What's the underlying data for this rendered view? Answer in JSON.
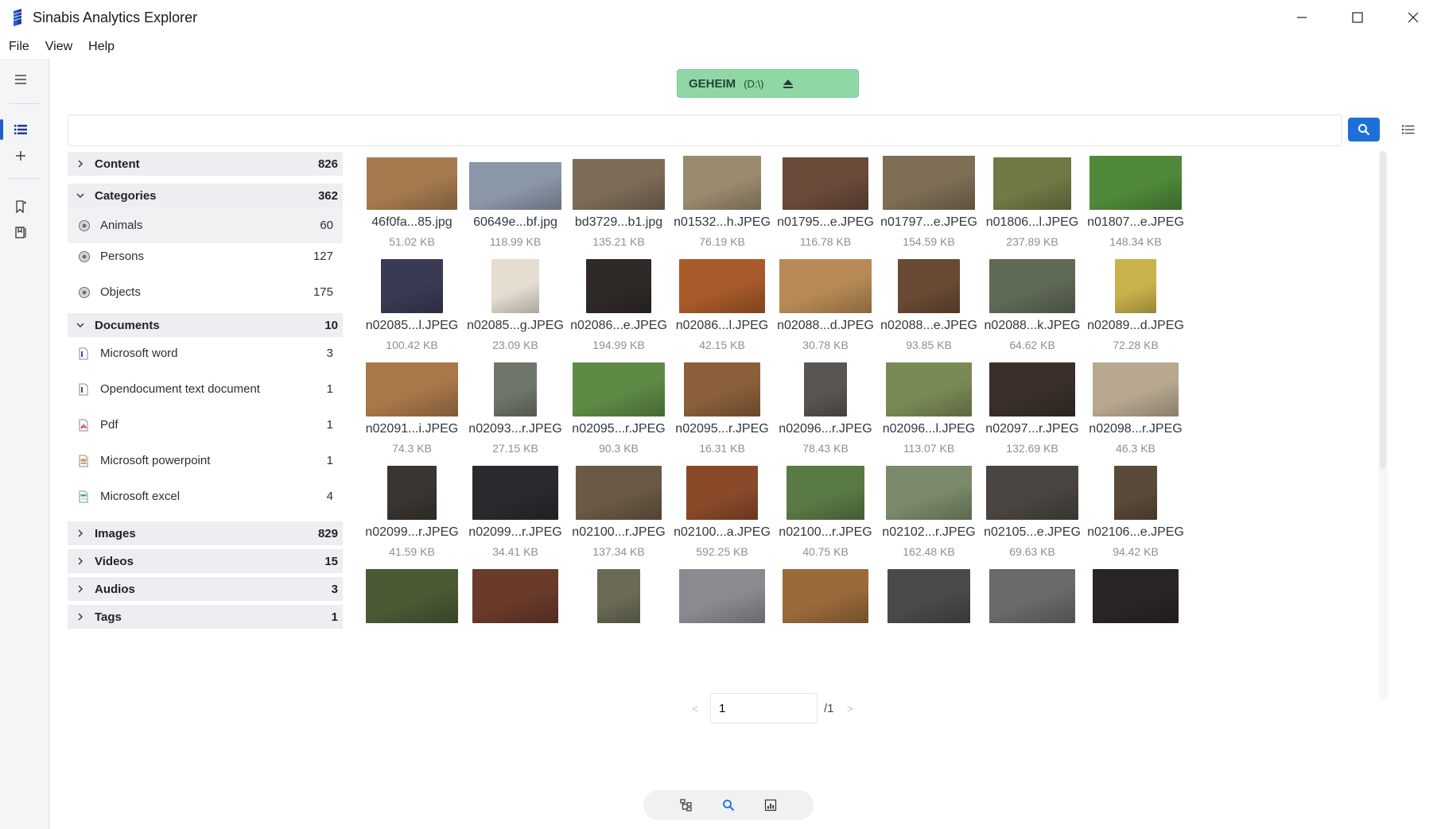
{
  "window": {
    "title": "Sinabis Analytics Explorer",
    "controls": [
      "minimize-icon",
      "maximize-icon",
      "close-icon"
    ]
  },
  "menu": [
    "File",
    "View",
    "Help"
  ],
  "rail": {
    "icons": [
      "hamburger-menu-icon",
      "list-view-icon",
      "plus-icon",
      "bookmark-add-icon",
      "bookmarks-icon"
    ],
    "active": "list-view-icon"
  },
  "drive": {
    "name": "GEHEIM",
    "path": "(D:\\)",
    "action_icon": "eject-icon",
    "color": "#8fd8a6"
  },
  "search": {
    "value": "",
    "placeholder": "",
    "button_icon": "search-icon",
    "accent": "#1e6fd9"
  },
  "facets": {
    "content": {
      "label": "Content",
      "count": "826",
      "expanded": false
    },
    "categories": {
      "label": "Categories",
      "count": "362",
      "expanded": true,
      "items": [
        {
          "label": "Animals",
          "count": "60",
          "selected": true
        },
        {
          "label": "Persons",
          "count": "127"
        },
        {
          "label": "Objects",
          "count": "175"
        }
      ]
    },
    "documents": {
      "label": "Documents",
      "count": "10",
      "expanded": true,
      "items": [
        {
          "label": "Microsoft word",
          "count": "3",
          "icon": "word-doc-icon"
        },
        {
          "label": "Opendocument text document",
          "count": "1",
          "icon": "odt-doc-icon"
        },
        {
          "label": "Pdf",
          "count": "1",
          "icon": "pdf-icon"
        },
        {
          "label": "Microsoft powerpoint",
          "count": "1",
          "icon": "powerpoint-icon"
        },
        {
          "label": "Microsoft excel",
          "count": "4",
          "icon": "excel-icon"
        }
      ]
    },
    "images": {
      "label": "Images",
      "count": "829",
      "expanded": false
    },
    "videos": {
      "label": "Videos",
      "count": "15",
      "expanded": false
    },
    "audios": {
      "label": "Audios",
      "count": "3",
      "expanded": false
    },
    "tags": {
      "label": "Tags",
      "count": "1",
      "expanded": false
    }
  },
  "files": [
    {
      "name": "46f0fa...85.jpg",
      "size": "51.02 KB",
      "color": "#a67a4f"
    },
    {
      "name": "60649e...bf.jpg",
      "size": "118.99 KB",
      "color": "#8a97a8"
    },
    {
      "name": "bd3729...b1.jpg",
      "size": "135.21 KB",
      "color": "#7b6b57"
    },
    {
      "name": "n01532...h.JPEG",
      "size": "76.19 KB",
      "color": "#9a8a6e"
    },
    {
      "name": "n01795...e.JPEG",
      "size": "116.78 KB",
      "color": "#6b4a3a"
    },
    {
      "name": "n01797...e.JPEG",
      "size": "154.59 KB",
      "color": "#7d6e55"
    },
    {
      "name": "n01806...l.JPEG",
      "size": "237.89 KB",
      "color": "#6f7a45"
    },
    {
      "name": "n01807...e.JPEG",
      "size": "148.34 KB",
      "color": "#4f8a3a"
    },
    {
      "name": "n02085...l.JPEG",
      "size": "100.42 KB",
      "color": "#3a3a55"
    },
    {
      "name": "n02085...g.JPEG",
      "size": "23.09 KB",
      "color": "#e5ddd0"
    },
    {
      "name": "n02086...e.JPEG",
      "size": "194.99 KB",
      "color": "#2f2a28"
    },
    {
      "name": "n02086...l.JPEG",
      "size": "42.15 KB",
      "color": "#a85a2a"
    },
    {
      "name": "n02088...d.JPEG",
      "size": "30.78 KB",
      "color": "#b78a55"
    },
    {
      "name": "n02088...e.JPEG",
      "size": "93.85 KB",
      "color": "#6a4a35"
    },
    {
      "name": "n02088...k.JPEG",
      "size": "64.62 KB",
      "color": "#5f6a55"
    },
    {
      "name": "n02089...d.JPEG",
      "size": "72.28 KB",
      "color": "#c9b24a"
    },
    {
      "name": "n02091...i.JPEG",
      "size": "74.3 KB",
      "color": "#a8774a"
    },
    {
      "name": "n02093...r.JPEG",
      "size": "27.15 KB",
      "color": "#6f756a"
    },
    {
      "name": "n02095...r.JPEG",
      "size": "90.3 KB",
      "color": "#5f8a45"
    },
    {
      "name": "n02095...r.JPEG",
      "size": "16.31 KB",
      "color": "#8a5f3a"
    },
    {
      "name": "n02096...r.JPEG",
      "size": "78.43 KB",
      "color": "#5a5550"
    },
    {
      "name": "n02096...l.JPEG",
      "size": "113.07 KB",
      "color": "#7a8a55"
    },
    {
      "name": "n02097...r.JPEG",
      "size": "132.69 KB",
      "color": "#3a2f2a"
    },
    {
      "name": "n02098...r.JPEG",
      "size": "46.3 KB",
      "color": "#b8a890"
    },
    {
      "name": "n02099...r.JPEG",
      "size": "41.59 KB",
      "color": "#3a3530"
    },
    {
      "name": "n02099...r.JPEG",
      "size": "34.41 KB",
      "color": "#2a2a2e"
    },
    {
      "name": "n02100...r.JPEG",
      "size": "137.34 KB",
      "color": "#6a5a45"
    },
    {
      "name": "n02100...a.JPEG",
      "size": "592.25 KB",
      "color": "#8a4a2a"
    },
    {
      "name": "n02100...r.JPEG",
      "size": "40.75 KB",
      "color": "#5a7a45"
    },
    {
      "name": "n02102...r.JPEG",
      "size": "162.48 KB",
      "color": "#7a8a6a"
    },
    {
      "name": "n02105...e.JPEG",
      "size": "69.63 KB",
      "color": "#4a4540"
    },
    {
      "name": "n02106...e.JPEG",
      "size": "94.42 KB",
      "color": "#5a4a3a"
    },
    {
      "name": "",
      "size": "",
      "color": "#4a5a35"
    },
    {
      "name": "",
      "size": "",
      "color": "#6a3a2a"
    },
    {
      "name": "",
      "size": "",
      "color": "#6a6a55"
    },
    {
      "name": "",
      "size": "",
      "color": "#8a8a90"
    },
    {
      "name": "",
      "size": "",
      "color": "#9a6a3a"
    },
    {
      "name": "",
      "size": "",
      "color": "#4a4a48"
    },
    {
      "name": "",
      "size": "",
      "color": "#6a6a6a"
    },
    {
      "name": "",
      "size": "",
      "color": "#2a2525"
    }
  ],
  "pager": {
    "prev": "<",
    "page": "1",
    "total": "/1",
    "next": ">"
  },
  "bottom_toolbar": [
    "tree-view-icon",
    "search-icon",
    "chart-icon"
  ]
}
